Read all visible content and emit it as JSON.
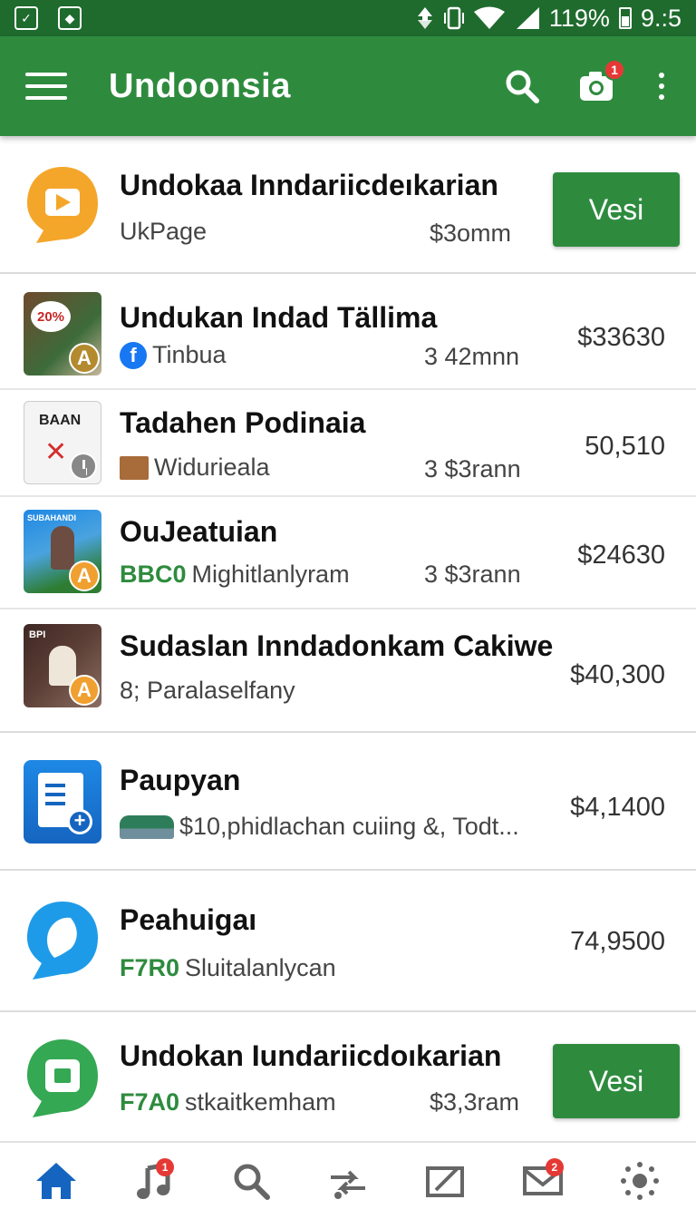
{
  "status_bar": {
    "battery_text": "119%",
    "time": "9.:5"
  },
  "app_bar": {
    "title": "Undoonsia",
    "camera_badge": "1"
  },
  "rows": [
    {
      "title": "Undokaa Inndariicdeıkarian",
      "subtitle": "UkPage",
      "mid": "$3оmm",
      "price": "",
      "button": "Vesi"
    },
    {
      "title": "Undukan Indad Tällima",
      "subtitle": "Tinbua",
      "mid": "3 42mnn",
      "price": "$33630",
      "thumb_label": "20%"
    },
    {
      "title": "Tadahen Podinaia",
      "subtitle": "Widurieala",
      "mid": "3 $3rann",
      "price": "50,510",
      "thumb_label": "BAAN"
    },
    {
      "title": "OuJeatuian",
      "tag": "BBC0",
      "subtitle": "Mighitlanlyram",
      "mid": "3 $3rann",
      "price": "$24630",
      "thumb_label": "SUBAHANDI"
    },
    {
      "title": "Sudaslan Inndadonkam Cakiwe",
      "subtitle": "8; Paralaselfany",
      "mid": "",
      "price": "$40,300",
      "thumb_label": "BPI"
    },
    {
      "title": "Paupyan",
      "subtitle": "$10,phidlachan cuiing &, Todt...",
      "mid": "",
      "price": "$4,1400"
    },
    {
      "title": "Peahuigaı",
      "tag": "F7R0",
      "subtitle": "Sluitalanlycan",
      "mid": "",
      "price": "74,9500"
    },
    {
      "title": "Undokan Iundariicdoıkarian",
      "tag": "F7A0",
      "subtitle": "stkaitkemham",
      "mid": "$3,3ram",
      "price": "",
      "button": "Vesi"
    }
  ],
  "bottom_nav": {
    "music_badge": "1",
    "mail_badge": "2"
  },
  "colors": {
    "status_bar": "#1f6b2e",
    "app_bar": "#2e8b3e",
    "accent_blue": "#1565c0",
    "badge_red": "#e53935"
  },
  "icons": [
    "menu-icon",
    "search-icon",
    "camera-icon",
    "more-vert-icon",
    "home-icon",
    "music-icon",
    "search-icon",
    "route-icon",
    "edit-icon",
    "mail-icon",
    "settings-icon"
  ]
}
